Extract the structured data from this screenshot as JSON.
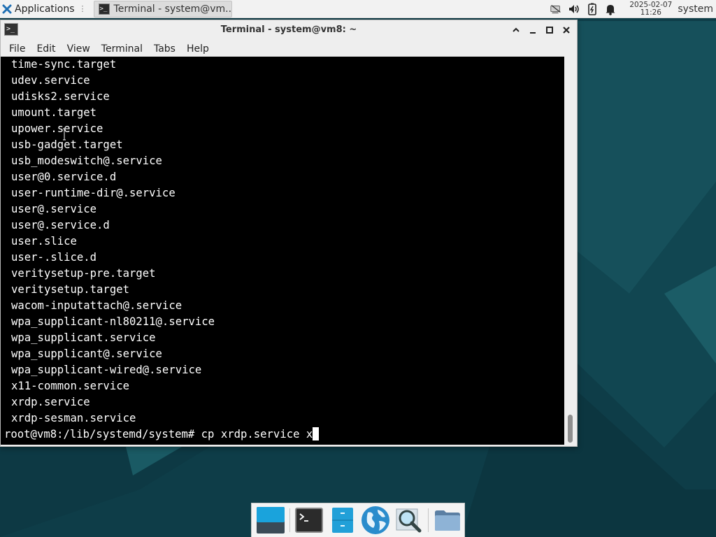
{
  "panel": {
    "applications_label": "Applications",
    "task_label": "Terminal - system@vm...",
    "clock_date": "2025-02-07",
    "clock_time": "11:26",
    "user_label": "system",
    "icons": [
      "network-icon",
      "volume-icon",
      "battery-icon",
      "notification-bell-icon"
    ]
  },
  "window": {
    "title": "Terminal - system@vm8: ~",
    "menu": [
      "File",
      "Edit",
      "View",
      "Terminal",
      "Tabs",
      "Help"
    ]
  },
  "terminal": {
    "lines": [
      "time-sync.target",
      "udev.service",
      "udisks2.service",
      "umount.target",
      "upower.service",
      "usb-gadget.target",
      "usb_modeswitch@.service",
      "user@0.service.d",
      "user-runtime-dir@.service",
      "user@.service",
      "user@.service.d",
      "user.slice",
      "user-.slice.d",
      "veritysetup-pre.target",
      "veritysetup.target",
      "wacom-inputattach@.service",
      "wpa_supplicant-nl80211@.service",
      "wpa_supplicant.service",
      "wpa_supplicant@.service",
      "wpa_supplicant-wired@.service",
      "x11-common.service",
      "xrdp.service",
      "xrdp-sesman.service"
    ],
    "prompt": "root@vm8:/lib/systemd/system# ",
    "command": "cp xrdp.service x"
  },
  "dock": {
    "items": [
      "show-desktop-icon",
      "terminal-icon",
      "file-cabinet-icon",
      "web-browser-icon",
      "search-icon",
      "folder-icon"
    ]
  },
  "colors": {
    "terminal_bg": "#000000",
    "terminal_fg": "#ffffff",
    "window_bg": "#eeeeee",
    "desktop": "#0f3f4b"
  }
}
